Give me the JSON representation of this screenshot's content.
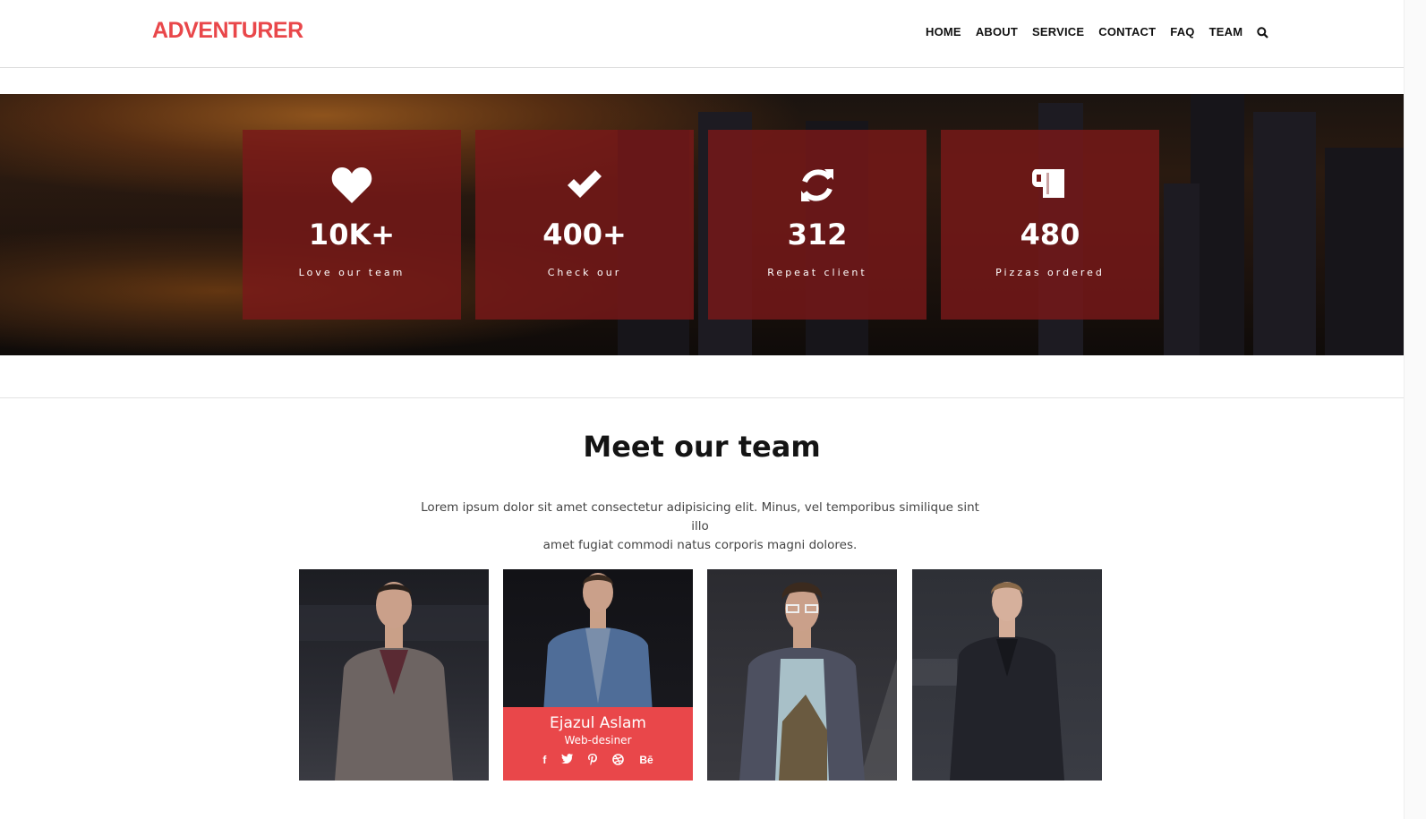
{
  "brand": {
    "logo": "ADVENTURER",
    "accent": "#e9474a",
    "stat_box": "#791818"
  },
  "nav": {
    "items": [
      "HOME",
      "ABOUT",
      "SERVICE",
      "CONTACT",
      "FAQ",
      "TEAM"
    ],
    "search_icon": "search-icon"
  },
  "stats": [
    {
      "icon": "heart-icon",
      "value": "10K+",
      "label": "Love our team"
    },
    {
      "icon": "check-icon",
      "value": "400+",
      "label": "Check our"
    },
    {
      "icon": "refresh-icon",
      "value": "312",
      "label": "Repeat client"
    },
    {
      "icon": "mug-icon",
      "value": "480",
      "label": "Pizzas ordered"
    }
  ],
  "team": {
    "title": "Meet our team",
    "description_line1": "Lorem ipsum dolor sit amet consectetur adipisicing elit. Minus, vel temporibus similique sint illo",
    "description_line2": "amet fugiat commodi natus corporis magni dolores.",
    "members": [
      {
        "photo": "man-in-tweed-suit"
      },
      {
        "photo": "man-in-blue-blazer",
        "name": "Ejazul Aslam",
        "role": "Web-desiner",
        "socials": [
          "f",
          "t",
          "p",
          "d",
          "Bē"
        ]
      },
      {
        "photo": "man-with-glasses"
      },
      {
        "photo": "man-in-dark-suit"
      }
    ]
  }
}
